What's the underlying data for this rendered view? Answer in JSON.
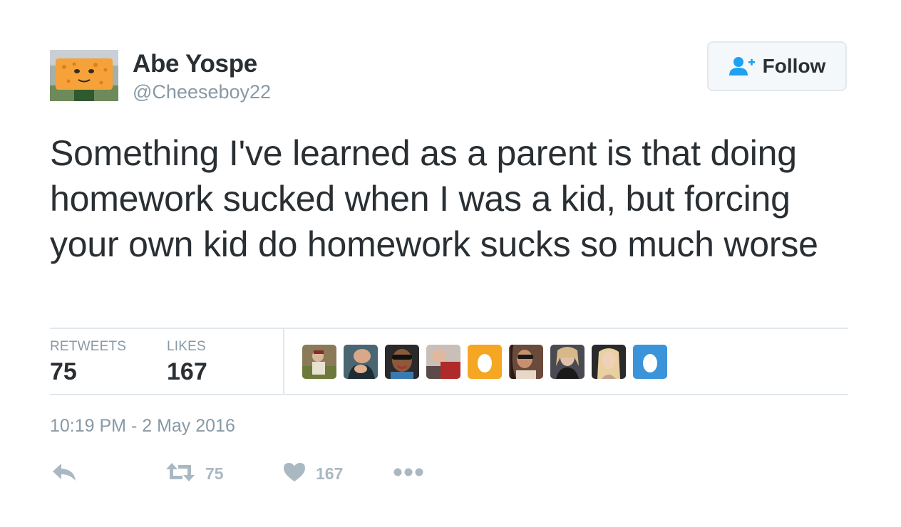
{
  "author": {
    "name": "Abe Yospe",
    "handle": "@Cheeseboy22",
    "avatar_icon": "cheese-face-avatar"
  },
  "follow_button": {
    "label": "Follow",
    "icon": "add-user-icon",
    "icon_color": "#1da1f2"
  },
  "tweet": {
    "text": "Something I've learned as a parent is that doing homework sucked when I was a kid, but forcing your own kid do homework sucks so much worse"
  },
  "stats": {
    "retweets_label": "RETWEETS",
    "retweets_count": "75",
    "likes_label": "LIKES",
    "likes_count": "167"
  },
  "likers": [
    {
      "icon": "user-photo-avatar",
      "color": "#8a7a58"
    },
    {
      "icon": "user-photo-avatar",
      "color": "#4a6672"
    },
    {
      "icon": "user-photo-avatar",
      "color": "#5a3a28"
    },
    {
      "icon": "user-photo-avatar",
      "color": "#b07058"
    },
    {
      "icon": "default-egg-avatar",
      "color": "#f5a623"
    },
    {
      "icon": "user-photo-avatar",
      "color": "#6a4a3a"
    },
    {
      "icon": "user-photo-avatar",
      "color": "#4a4a52"
    },
    {
      "icon": "user-photo-avatar",
      "color": "#c8b090"
    },
    {
      "icon": "default-egg-avatar",
      "color": "#3b94d9"
    }
  ],
  "timestamp": "10:19 PM - 2 May 2016",
  "actions": {
    "reply_icon": "reply-icon",
    "retweet_icon": "retweet-icon",
    "retweet_count": "75",
    "like_icon": "heart-icon",
    "like_count": "167",
    "more_icon": "more-icon"
  },
  "colors": {
    "text": "#292f33",
    "muted": "#8899a6",
    "action": "#aab8c2",
    "border": "#e1e8ed",
    "accent": "#1da1f2"
  }
}
